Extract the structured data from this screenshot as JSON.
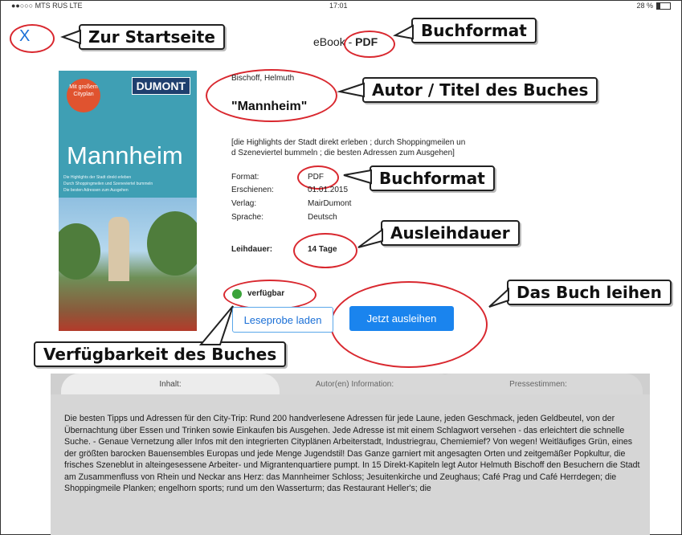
{
  "status_bar": {
    "carrier": "●●○○○ MTS RUS  LTE",
    "time": "17:01",
    "battery": "28 %"
  },
  "nav": {
    "close": "X",
    "title_prefix": "eBook - ",
    "title_format": "PDF"
  },
  "callouts": {
    "home": "Zur Startseite",
    "format_top": "Buchformat",
    "author_title": "Autor / Titel des Buches",
    "format_mid": "Buchformat",
    "loan_period": "Ausleihdauer",
    "borrow": "Das Buch leihen",
    "availability": "Verfügbarkeit des Buches"
  },
  "cover": {
    "badge": "Mit großem Cityplan",
    "brand": "DUMONT",
    "city": "Mannheim",
    "line1": "Die Highlights der Stadt direkt erleben",
    "line2": "Durch Shoppingmeilen und Szeneviertel bummeln",
    "line3": "Die besten Adressen zum Ausgehen"
  },
  "book": {
    "author": "Bischoff, Helmuth",
    "title": "\"Mannheim\"",
    "subtitle_l1": "[die Highlights der Stadt direkt erleben ; durch Shoppingmeilen un",
    "subtitle_l2": "d Szeneviertel bummeln ; die besten Adressen zum Ausgehen]",
    "meta": [
      {
        "label": "Format:",
        "value": "PDF"
      },
      {
        "label": "Erschienen:",
        "value": "01.01.2015"
      },
      {
        "label": "Verlag:",
        "value": "MairDumont"
      },
      {
        "label": "Sprache:",
        "value": "Deutsch"
      }
    ],
    "loan_label": "Leihdauer:",
    "loan_value": "14 Tage",
    "availability": "verfügbar"
  },
  "buttons": {
    "preview": "Leseprobe laden",
    "borrow": "Jetzt ausleihen"
  },
  "tabs": [
    {
      "label": "Inhalt:"
    },
    {
      "label": "Autor(en) Information:"
    },
    {
      "label": "Pressestimmen:"
    }
  ],
  "content": "Die besten Tipps und Adressen für den City-Trip: Rund 200 handverlesene Adressen für jede Laune, jeden Geschmack, jeden Geldbeutel, von der Übernachtung über Essen und Trinken sowie Einkaufen bis Ausgehen. Jede Adresse ist mit einem Schlagwort versehen - das erleichtert die schnelle Suche. - Genaue Vernetzung aller Infos mit den integrierten Cityplänen Arbeiterstadt, Industriegrau, Chemiemief? Von wegen! Weitläufiges Grün, eines der größten barocken Bauensembles Europas und jede Menge Jugendstil! Das Ganze garniert mit angesagten Orten und zeitgemäßer Popkultur, die frisches Szeneblut in alteingesessene Arbeiter- und Migrantenquartiere pumpt. In 15 Direkt-Kapiteln legt Autor Helmuth Bischoff den Besuchern die Stadt am Zusammenfluss von Rhein und Neckar ans Herz: das Mannheimer Schloss; Jesuitenkirche und Zeughaus; Café Prag und Café Herrdegen; die Shoppingmeile Planken; engelhorn sports; rund um den Wasserturm; das Restaurant Heller's; die",
  "colors": {
    "accent": "#1a84ee",
    "annotation": "#d9282f",
    "available": "#3aa33a"
  }
}
